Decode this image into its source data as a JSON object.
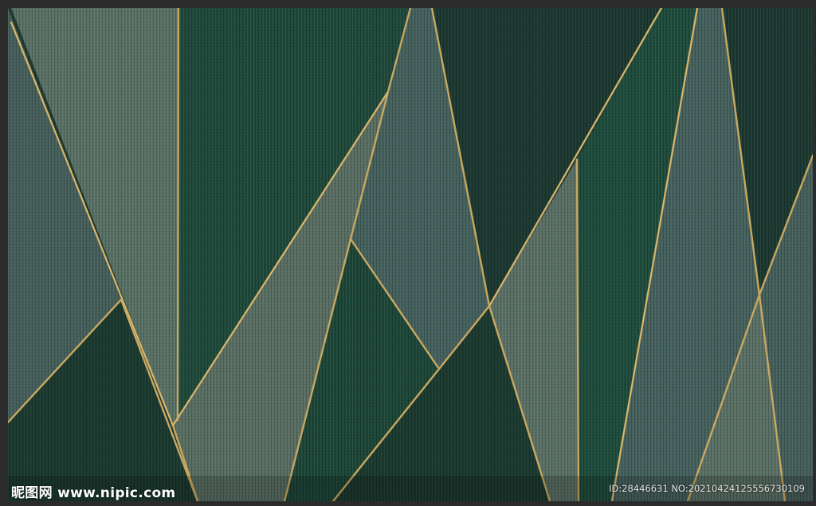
{
  "artwork": {
    "palette": {
      "frame": "#2b2b2b",
      "emerald": "#1f4a3c",
      "deep_green": "#1b3a30",
      "sage": "#5c7368",
      "slate_teal": "#46625e",
      "gold": "#c9a860"
    }
  },
  "watermark": {
    "site": "昵图网 www.nipic.com",
    "id_text": "ID:28446631 NO:20210424125556730109"
  }
}
